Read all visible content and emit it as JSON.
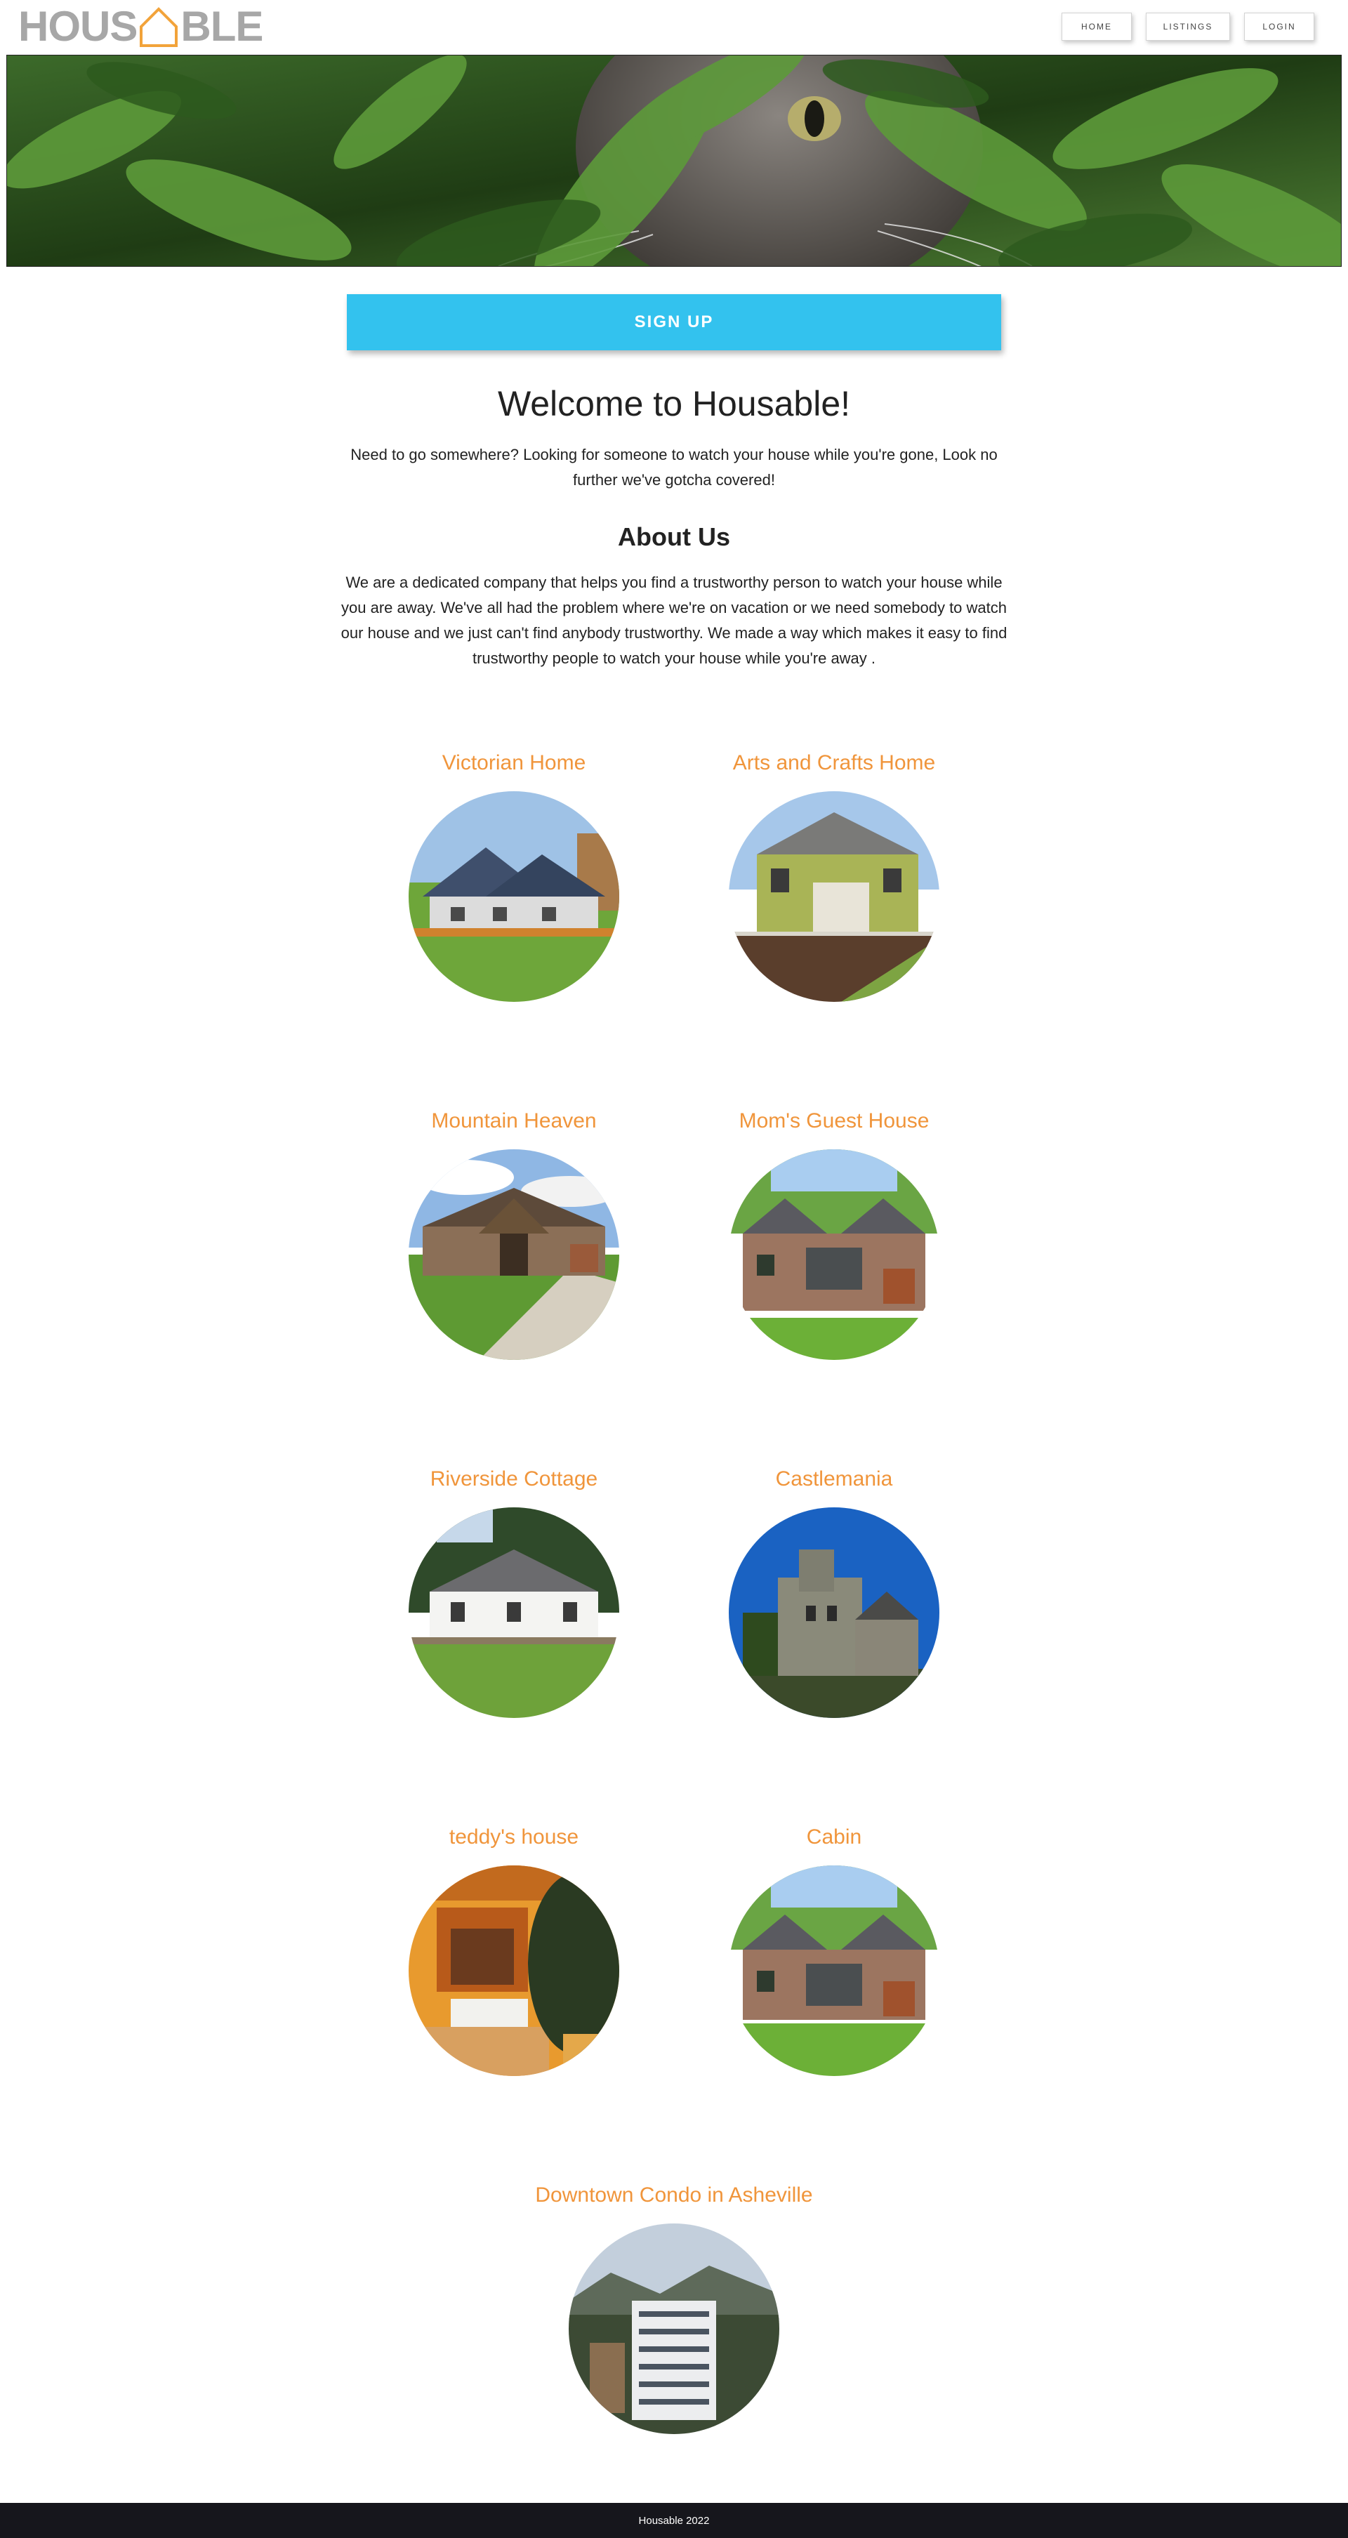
{
  "header": {
    "logo_left": "HOUS",
    "logo_right": "BLE",
    "logo_accent_color": "#f2a33a",
    "nav": {
      "home": "HOME",
      "listings": "LISTINGS",
      "login": "LOGIN"
    }
  },
  "hero": {
    "icon": "cat-in-foliage-photo"
  },
  "signup": {
    "label": "SIGN UP",
    "color": "#33c2ee"
  },
  "welcome": {
    "title": "Welcome to Housable!",
    "text": "Need to go somewhere? Looking for someone to watch your house while you're gone, Look no further we've gotcha covered!"
  },
  "about": {
    "title": "About Us",
    "text": "We are a dedicated company that helps you find a trustworthy person to watch your house while you are away. We've all had the problem where we're on vacation or we need somebody to watch our house and we just can't find anybody trustworthy. We made a way which makes it easy to find trustworthy people to watch your house while you're away ."
  },
  "listings": [
    {
      "title": "Victorian Home"
    },
    {
      "title": "Arts and Crafts Home"
    },
    {
      "title": "Mountain Heaven"
    },
    {
      "title": "Mom's Guest House"
    },
    {
      "title": "Riverside Cottage"
    },
    {
      "title": "Castlemania"
    },
    {
      "title": "teddy's house"
    },
    {
      "title": "Cabin"
    },
    {
      "title": "Downtown Condo in Asheville"
    }
  ],
  "listing_title_color": "#f0953b",
  "footer": {
    "text": "Housable 2022"
  }
}
